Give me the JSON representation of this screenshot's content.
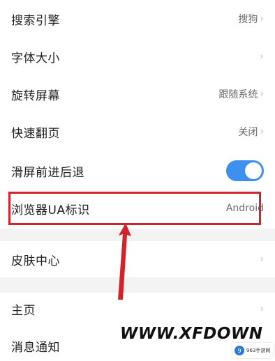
{
  "settings": {
    "rows": [
      {
        "label": "搜索引擎",
        "value": "搜狗"
      },
      {
        "label": "字体大小",
        "value": ""
      },
      {
        "label": "旋转屏幕",
        "value": "跟随系统"
      },
      {
        "label": "快速翻页",
        "value": "关闭"
      },
      {
        "label": "滑屏前进后退",
        "toggle": true
      },
      {
        "label": "浏览器UA标识",
        "value": "Android"
      },
      {
        "label": "皮肤中心",
        "value": ""
      },
      {
        "label": "主页",
        "value": ""
      },
      {
        "label": "消息通知",
        "value": ""
      }
    ],
    "chevron": "›"
  },
  "watermark": {
    "text": "WWW.XFDOWN",
    "badge_text": "963手游网",
    "badge_icon_text": "9"
  },
  "colors": {
    "toggle_on": "#3d8ff0",
    "highlight": "#d2232a",
    "section_gap": "#f3f3f3"
  }
}
